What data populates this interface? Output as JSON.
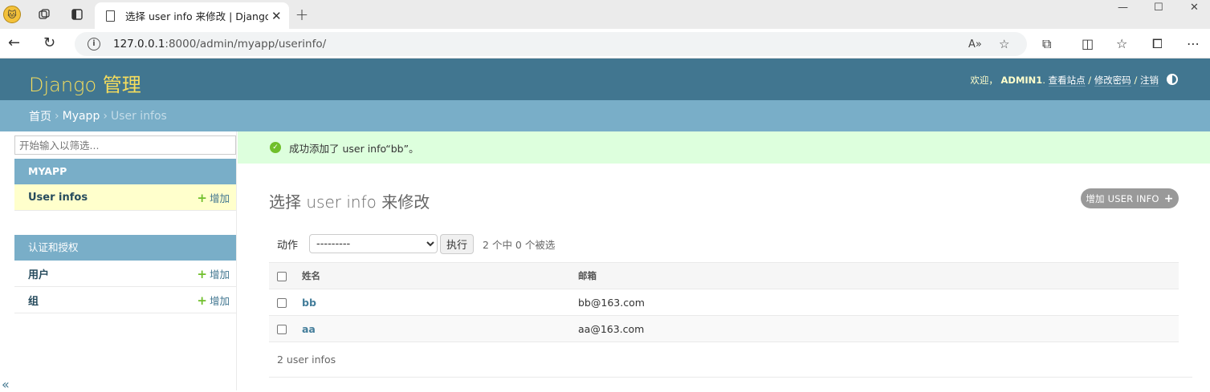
{
  "browser": {
    "tab_title": "选择 user info 来修改 | Django 站",
    "url_host": "127.0.0.1",
    "url_path": ":8000/admin/myapp/userinfo/"
  },
  "header": {
    "brand": "Django 管理",
    "welcome": "欢迎，",
    "username": "ADMIN1",
    "view_site": "查看站点",
    "change_password": "修改密码",
    "logout": "注销",
    "sep": "/"
  },
  "breadcrumbs": {
    "home": "首页",
    "app": "Myapp",
    "current": "User infos",
    "sep": "›"
  },
  "sidebar": {
    "filter_placeholder": "开始输入以筛选...",
    "modules": [
      {
        "caption": "MYAPP",
        "items": [
          {
            "label": "User infos",
            "add_label": "增加"
          }
        ]
      },
      {
        "caption": "认证和授权",
        "items": [
          {
            "label": "用户",
            "add_label": "增加"
          },
          {
            "label": "组",
            "add_label": "增加"
          }
        ]
      }
    ],
    "collapse_glyph": "«"
  },
  "message": {
    "text": "成功添加了 user info“bb”。"
  },
  "content": {
    "title": "选择 user info 来修改",
    "add_button": "增加 USER INFO",
    "actions": {
      "label": "动作",
      "selected": "---------",
      "go_label": "执行",
      "counter": "2 个中 0 个被选"
    },
    "table": {
      "columns": [
        "姓名",
        "邮箱"
      ],
      "rows": [
        {
          "name": "bb",
          "email": "bb@163.com"
        },
        {
          "name": "aa",
          "email": "aa@163.com"
        }
      ]
    },
    "paginator": "2 user infos"
  },
  "colors": {
    "header": "#417690",
    "breadcrumbs": "#79aec8",
    "brand": "#f5dd5d",
    "success_bg": "#dfd",
    "add_green": "#70bf2b"
  }
}
